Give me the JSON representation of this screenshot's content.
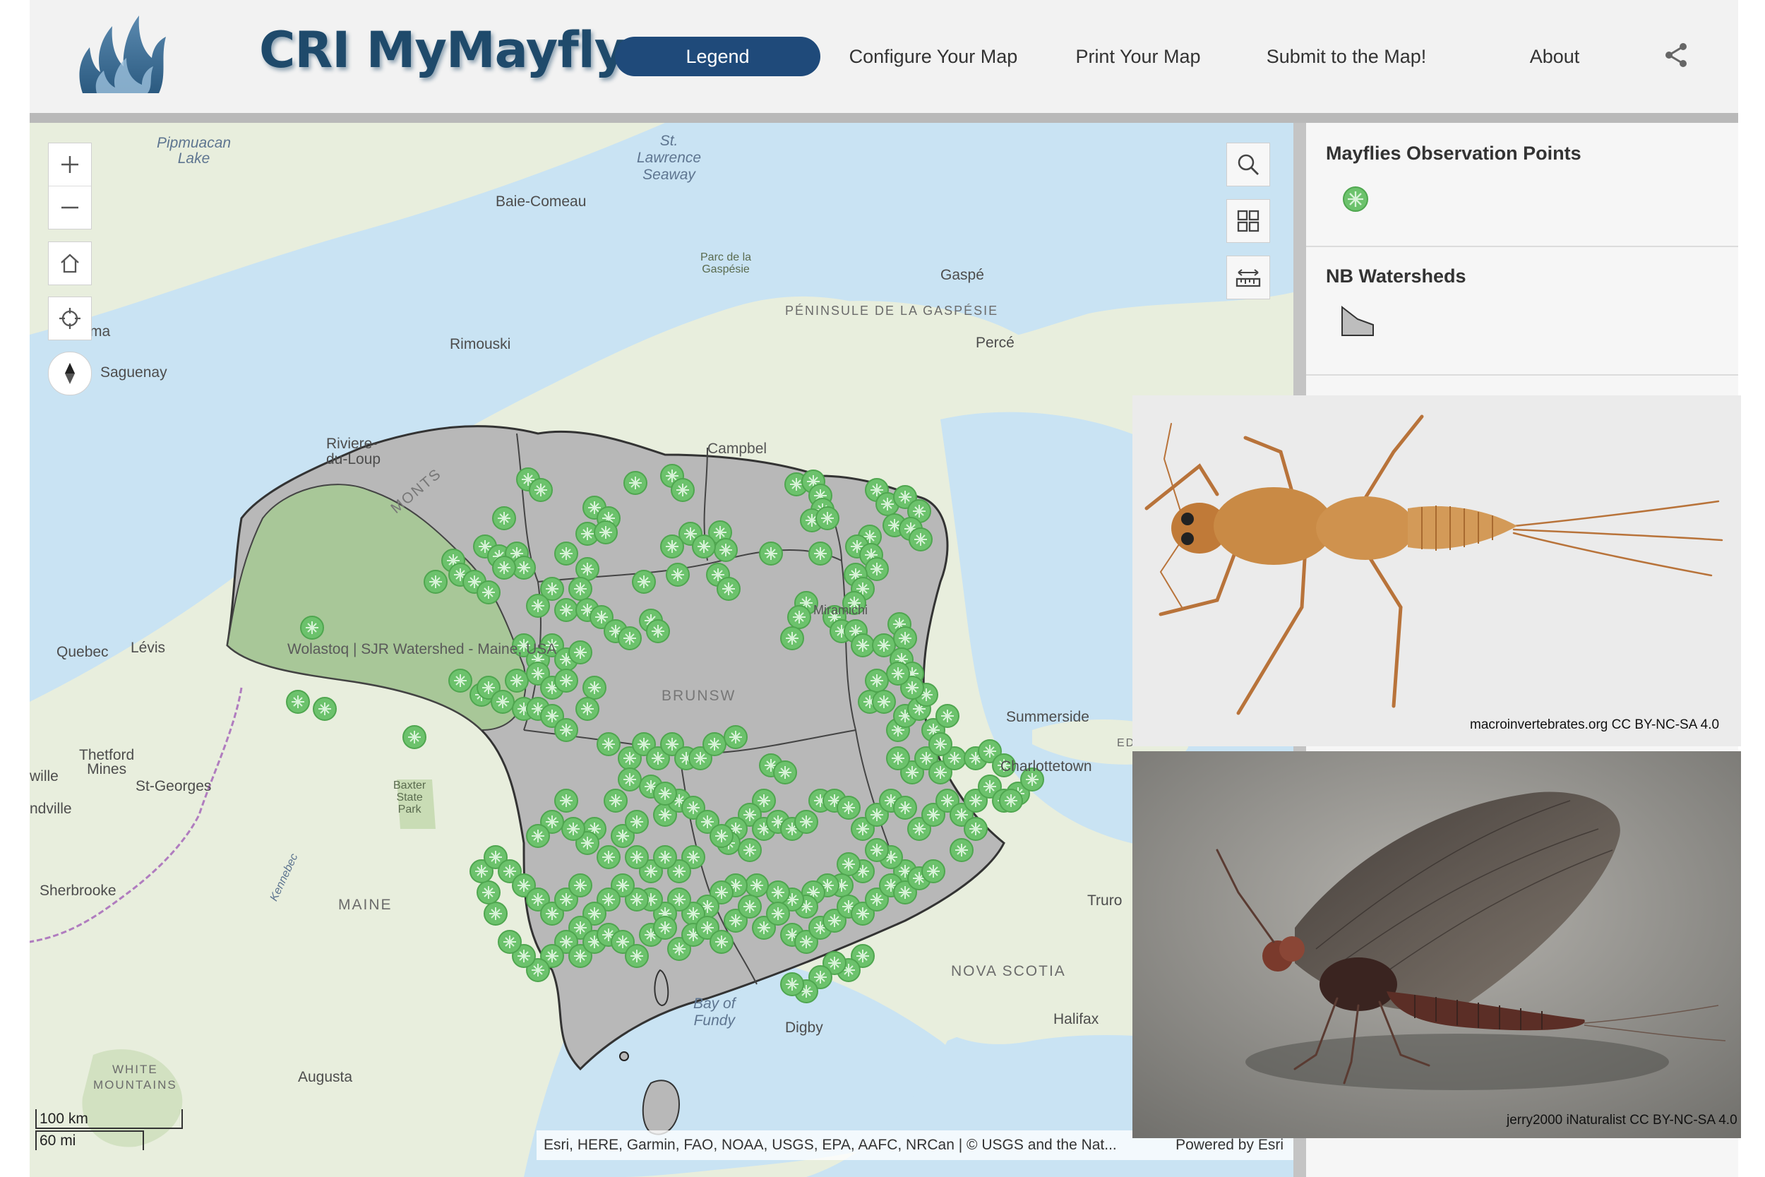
{
  "header": {
    "title": "CRI MyMayfly",
    "nav": [
      {
        "label": "Legend",
        "active": true
      },
      {
        "label": "Configure Your Map"
      },
      {
        "label": "Print Your Map"
      },
      {
        "label": "Submit to the Map!"
      },
      {
        "label": "About"
      }
    ],
    "share_icon": "share-icon"
  },
  "map": {
    "labels": {
      "pipmuacan": "Pipmuacan\nLake",
      "st_lawrence": "St.\nLawrence\nSeaway",
      "baie_comeau": "Baie-Comeau",
      "parc_gaspesie": "Parc de la\nGaspésie",
      "gaspe": "Gaspé",
      "peninsule": "PÉNINSULE DE LA GASPÉSIE",
      "perce": "Percé",
      "rimouski": "Rimouski",
      "ma": "ma",
      "saguenay": "Saguenay",
      "riviere_du_loup": "Riviere-\ndu-Loup",
      "quebec": "Quebec",
      "levis": "Lévis",
      "watershed": "Wolastoq | SJR Watershed - Maine, USA",
      "thetford": "Thetford\nMines",
      "st_georges": "St-Georges",
      "ville": "wille",
      "ndville": "ndville",
      "baxter": "Baxter\nState\nPark",
      "sherbrooke": "Sherbrooke",
      "maine": "MAINE",
      "kennebec": "Kennebec",
      "white_mountains": "WHITE\nMOUNTAINS",
      "augusta": "Augusta",
      "summerside": "Summerside",
      "charlottetown": "Charlottetown",
      "edward": "EDWARD",
      "truro": "Truro",
      "nova_scotia": "NOVA SCOTIA",
      "bay_fundy": "Bay of\nFundy",
      "digby": "Digby",
      "halifax": "Halifax",
      "campbell": "Campbel",
      "brunswick": "BRUNSW",
      "monts": "MONTS",
      "miramichi": "Miramichi"
    },
    "controls": {
      "zoom_in": "zoom-in",
      "zoom_out": "zoom-out",
      "home": "home",
      "locate": "locate",
      "compass": "compass",
      "search": "search",
      "basemap": "basemap-gallery",
      "measure": "measure"
    },
    "attribution": "Esri, HERE, Garmin, FAO, NOAA, USGS, EPA, AAFC, NRCan | © USGS and the Nat...",
    "powered_by": "Powered by Esri",
    "scale": {
      "km": "100 km",
      "mi": "60 mi"
    },
    "colors": {
      "land": "#e8eedd",
      "water": "#c9e3f3",
      "watershed": "#b8b8b8",
      "wolastoq": "#a8c798",
      "points": "#6cc26c"
    }
  },
  "legend": {
    "section1_title": "Mayflies Observation Points",
    "section2_title": "NB Watersheds"
  },
  "photos": {
    "nymph_credit": "macroinvertebrates.org CC BY-NC-SA 4.0",
    "adult_credit": "jerry2000 iNaturalist CC BY-NC-SA 4.0"
  }
}
